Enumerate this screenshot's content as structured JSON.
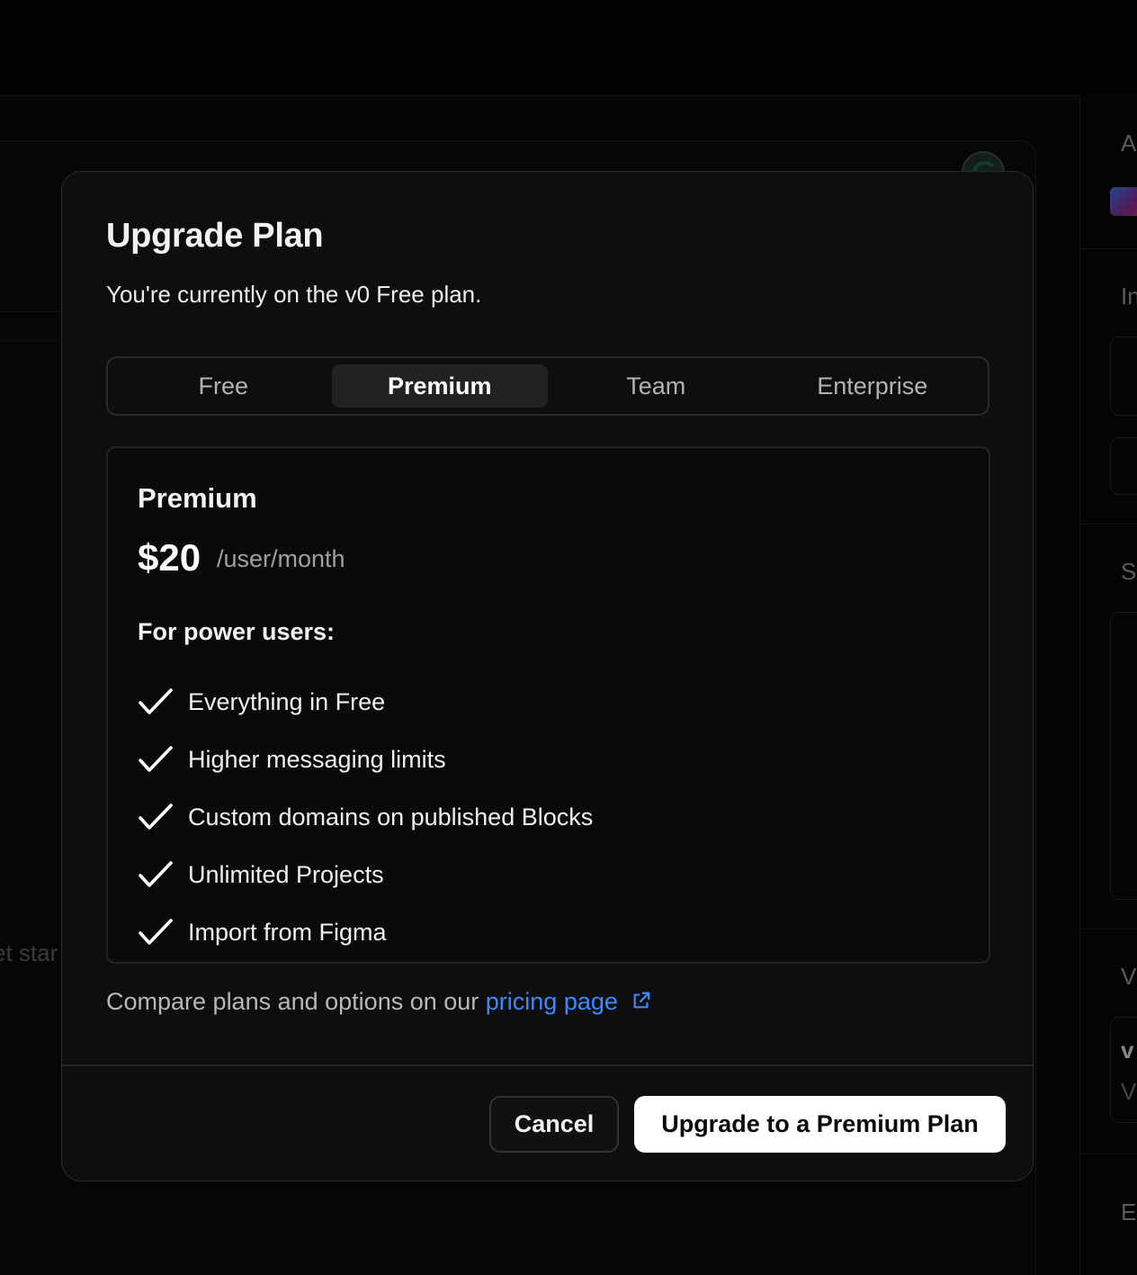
{
  "background": {
    "faded_text": "et star",
    "right_column_letters": [
      "A",
      "In",
      "S",
      "V",
      "v",
      "V",
      "E"
    ]
  },
  "modal": {
    "title": "Upgrade Plan",
    "subtitle": "You're currently on the v0 Free plan.",
    "tabs": [
      {
        "label": "Free",
        "active": false
      },
      {
        "label": "Premium",
        "active": true
      },
      {
        "label": "Team",
        "active": false
      },
      {
        "label": "Enterprise",
        "active": false
      }
    ],
    "plan": {
      "name": "Premium",
      "price": "$20",
      "period": "/user/month",
      "audience": "For power users:",
      "features": [
        "Everything in Free",
        "Higher messaging limits",
        "Custom domains on published Blocks",
        "Unlimited Projects",
        "Import from Figma"
      ]
    },
    "compare": {
      "text": "Compare plans and options on our ",
      "link_label": "pricing page",
      "link_icon": "external-link-icon"
    },
    "footer": {
      "cancel_label": "Cancel",
      "upgrade_label": "Upgrade to a Premium Plan"
    }
  },
  "colors": {
    "accent_link": "#3b8bff",
    "modal_bg": "#0e0e0e",
    "primary_button_bg": "#ffffff"
  }
}
